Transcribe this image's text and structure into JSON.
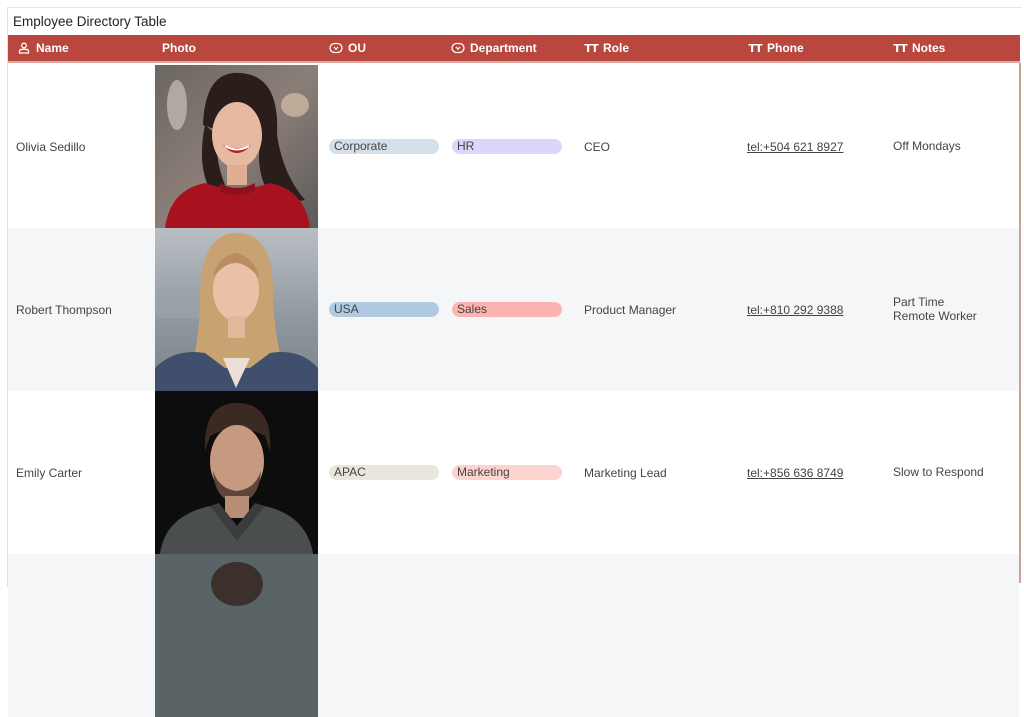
{
  "title": "Employee Directory Table",
  "columns": [
    {
      "label": "Name",
      "icon": "person-icon"
    },
    {
      "label": "Photo",
      "icon": ""
    },
    {
      "label": "OU",
      "icon": "dropdown-icon"
    },
    {
      "label": "Department",
      "icon": "dropdown-icon"
    },
    {
      "label": "Role",
      "icon": "text-icon"
    },
    {
      "label": "Phone",
      "icon": "text-icon"
    },
    {
      "label": "Notes",
      "icon": "text-icon"
    }
  ],
  "text_icon_glyph": "TT",
  "rows": [
    {
      "name": "Olivia Sedillo",
      "photo": "smiling woman with dark wavy hair in red sweater",
      "ou": "Corporate",
      "ou_color": "#d5dfe9",
      "department": "HR",
      "department_color": "#ddd5fb",
      "role": "CEO",
      "phone": "tel:+504 621 8927",
      "notes_line1": "Off Mondays",
      "notes_line2": ""
    },
    {
      "name": "Robert Thompson",
      "photo": "woman with long blonde hair",
      "ou": "USA",
      "ou_color": "#b1cae1",
      "department": "Sales",
      "department_color": "#fdb4b0",
      "role": "Product Manager",
      "phone": "tel:+810 292 9388",
      "notes_line1": "Part Time",
      "notes_line2": "Remote Worker"
    },
    {
      "name": "Emily Carter",
      "photo": "man with beard and sweater on black background",
      "ou": "APAC",
      "ou_color": "#ebe6db",
      "department": "Marketing",
      "department_color": "#fdd3d0",
      "role": "Marketing Lead",
      "phone": "tel:+856 636 8749",
      "notes_line1": "Slow to Respond",
      "notes_line2": ""
    }
  ]
}
